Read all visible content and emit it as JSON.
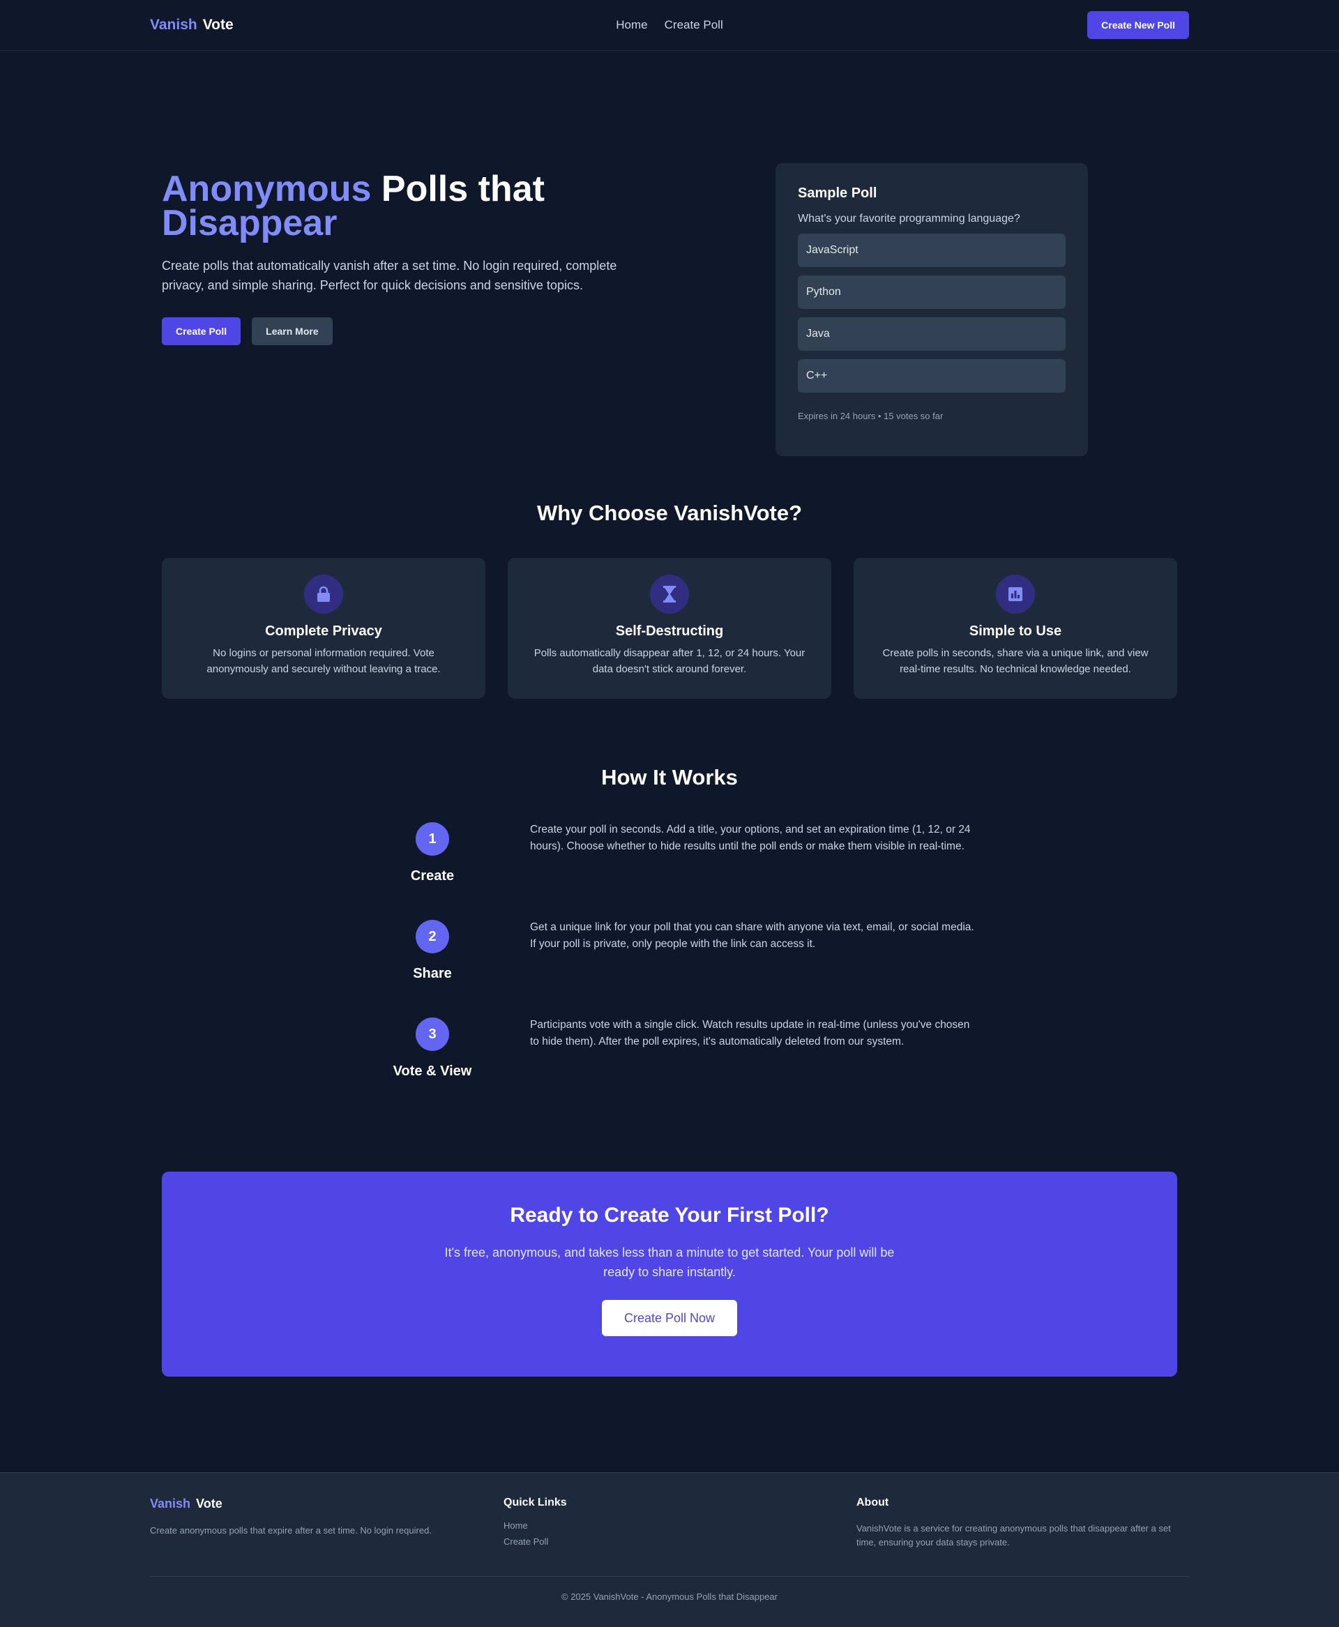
{
  "nav": {
    "logo_a": "Vanish",
    "logo_b": "Vote",
    "links": [
      "Home",
      "Create Poll"
    ],
    "cta": "Create New Poll"
  },
  "hero": {
    "title_highlight": "Anonymous",
    "title_rest": " Polls that",
    "title_line2": "Disappear",
    "subtitle": "Create polls that automatically vanish after a set time. No login required, complete privacy, and simple sharing. Perfect for quick decisions and sensitive topics.",
    "primary_btn": "Create Poll",
    "secondary_btn": "Learn More"
  },
  "sample_poll": {
    "title": "Sample Poll",
    "question": "What's your favorite programming language?",
    "options": [
      "JavaScript",
      "Python",
      "Java",
      "C++"
    ],
    "meta": "Expires in 24 hours • 15 votes so far"
  },
  "features": {
    "title": "Why Choose VanishVote?",
    "items": [
      {
        "icon": "lock-icon",
        "title": "Complete Privacy",
        "desc": "No logins or personal information required. Vote anonymously and securely without leaving a trace."
      },
      {
        "icon": "hourglass-icon",
        "title": "Self-Destructing",
        "desc": "Polls automatically disappear after 1, 12, or 24 hours. Your data doesn't stick around forever."
      },
      {
        "icon": "chart-icon",
        "title": "Simple to Use",
        "desc": "Create polls in seconds, share via a unique link, and view real-time results. No technical knowledge needed."
      }
    ]
  },
  "how": {
    "title": "How It Works",
    "steps": [
      {
        "num": "1",
        "name": "Create",
        "desc": "Create your poll in seconds. Add a title, your options, and set an expiration time (1, 12, or 24 hours). Choose whether to hide results until the poll ends or make them visible in real-time."
      },
      {
        "num": "2",
        "name": "Share",
        "desc": "Get a unique link for your poll that you can share with anyone via text, email, or social media. If your poll is private, only people with the link can access it."
      },
      {
        "num": "3",
        "name": "Vote & View",
        "desc": "Participants vote with a single click. Watch results update in real-time (unless you've chosen to hide them). After the poll expires, it's automatically deleted from our system."
      }
    ]
  },
  "cta": {
    "title": "Ready to Create Your First Poll?",
    "text": "It's free, anonymous, and takes less than a minute to get started. Your poll will be ready to share instantly.",
    "button": "Create Poll Now"
  },
  "footer": {
    "logo_a": "Vanish",
    "logo_b": "Vote",
    "tagline": "Create anonymous polls that expire after a set time. No login required.",
    "quick_links_title": "Quick Links",
    "quick_links": [
      "Home",
      "Create Poll"
    ],
    "about_title": "About",
    "about_text": "VanishVote is a service for creating anonymous polls that disappear after a set time, ensuring your data stays private.",
    "copyright": "© 2025 VanishVote - Anonymous Polls that Disappear"
  },
  "colors": {
    "background": "#0f172a",
    "card": "#1e293b",
    "accent": "#4f46e5",
    "highlight": "#818cf8"
  }
}
